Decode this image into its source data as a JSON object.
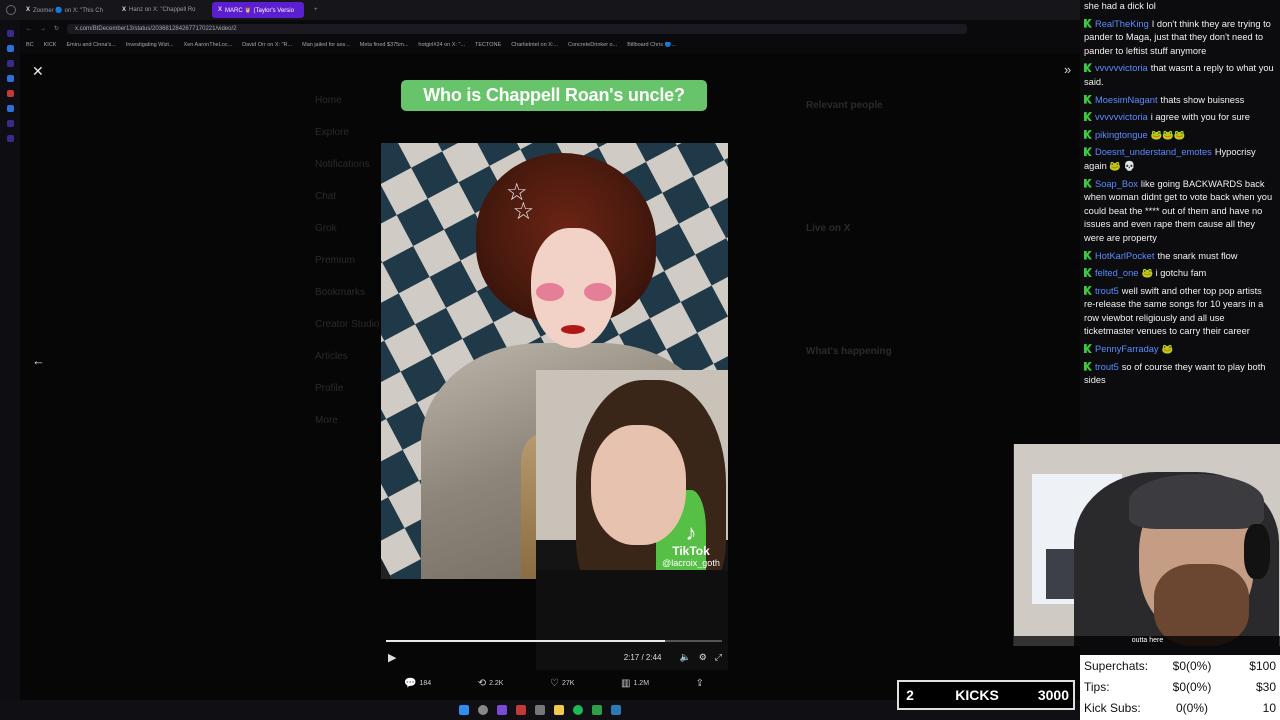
{
  "browser": {
    "tabs": [
      {
        "label": "Zoomer 🔵 on X: \"This Ch",
        "active": false
      },
      {
        "label": "Hanz on X: \"Chappell Ro",
        "active": false
      },
      {
        "label": "MARC 🦉 (Taylor's Versio",
        "active": true
      }
    ],
    "url": "x.com/BtDecember13/status/2036812842677170221/video/2",
    "bookmarks": [
      "BC",
      "KICK",
      "Emiru and Cinna's...",
      "Investigating Wizt...",
      "Xen AaronTheLoc...",
      "David Orr on X: \"R...",
      "Man jailed for ass...",
      "Meta fined $375m...",
      "hotgirl#24 on X: \"...",
      "TECTONE",
      "CharlieIntel on X:...",
      "ConcreteDrinker o...",
      "Billboard Chris 🔵..."
    ]
  },
  "ghost_page": {
    "nav": [
      "Home",
      "Explore",
      "Notifications",
      "Chat",
      "Grok",
      "Premium",
      "Bookmarks",
      "Creator Studio",
      "Articles",
      "Profile",
      "More"
    ],
    "right_headings": [
      "Relevant people",
      "Live on X",
      "What's happening"
    ]
  },
  "video": {
    "title": "Who is Chappell Roan's uncle?",
    "watermark_brand": "TikTok",
    "watermark_handle": "@lacroix_goth",
    "time": "2:17 / 2:44",
    "progress": 0.83
  },
  "stats": {
    "replies": "184",
    "reposts": "2.2K",
    "likes": "27K",
    "views": "1.2M"
  },
  "chat": {
    "messages": [
      {
        "user": "",
        "text": "she had a dick lol"
      },
      {
        "user": "RealTheKing",
        "text": "I don't think they are trying to pander to Maga, just that they don't need to pander to leftist stuff anymore"
      },
      {
        "user": "vvvvvvictoria",
        "text": "that wasnt a reply to what you said."
      },
      {
        "user": "MoesimNagant",
        "text": "thats show buisness"
      },
      {
        "user": "vvvvvvictoria",
        "text": "i agree with you for sure"
      },
      {
        "user": "pikingtongue",
        "text": "🐸🐸🐸"
      },
      {
        "user": "Doesnt_understand_emotes",
        "text": "Hypocrisy again 🐸 💀"
      },
      {
        "user": "Soap_Box",
        "text": "like going BACKWARDS back when woman didnt get to vote back when you could beat the **** out of them and have no issues and even rape them cause all they were are property"
      },
      {
        "user": "HotKarlPocket",
        "text": "the snark must flow"
      },
      {
        "user": "felted_one",
        "text": "🐸 i gotchu fam"
      },
      {
        "user": "trout5",
        "text": "well swift and other top pop artists re-release the same songs for 10 years in a row viewbot religiously and all use ticketmaster venues to carry their career"
      },
      {
        "user": "PennyFarraday",
        "text": "🐸"
      },
      {
        "user": "trout5",
        "text": "so of course they want to play both sides"
      }
    ]
  },
  "webcam": {
    "caption": "outta here"
  },
  "kicks": {
    "count": "2",
    "label": "KICKS",
    "goal": "3000"
  },
  "donations": [
    {
      "label": "Superchats:",
      "value": "$0(0%)",
      "goal": "$100"
    },
    {
      "label": "Tips:",
      "value": "$0(0%)",
      "goal": "$30"
    },
    {
      "label": "Kick Subs:",
      "value": "0(0%)",
      "goal": "10"
    }
  ],
  "colors": {
    "title_chip": "#68c46a",
    "active_tab": "#5b1fd1",
    "kick_green": "#3ccb3c",
    "username_blue": "#5b8cff"
  }
}
